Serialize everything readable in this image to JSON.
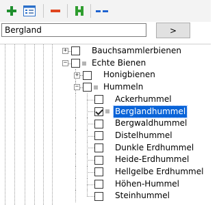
{
  "toolbar": {
    "buttons": [
      {
        "icon": "plus-icon"
      },
      {
        "icon": "properties-icon"
      },
      {
        "icon": "minus-icon"
      },
      {
        "icon": "h-icon"
      },
      {
        "icon": "dash-icon"
      }
    ],
    "colors": {
      "plus": "#1f8f2e",
      "minus": "#e0451f",
      "h": "#2f9d2f",
      "dash": "#1e62d0"
    }
  },
  "search": {
    "value": "Bergland",
    "button_label": ">"
  },
  "tree": {
    "items": [
      {
        "label": "Bauchsammlerbienen",
        "expander": "+",
        "checked": false,
        "marker": false,
        "selected": false
      },
      {
        "label": "Echte Bienen",
        "expander": "−",
        "checked": false,
        "marker": true,
        "selected": false
      },
      {
        "label": "Honigbienen",
        "expander": "+",
        "checked": false,
        "marker": false,
        "selected": false
      },
      {
        "label": "Hummeln",
        "expander": "−",
        "checked": false,
        "marker": true,
        "selected": false
      },
      {
        "label": "Ackerhummel",
        "expander": null,
        "checked": false,
        "marker": false,
        "selected": false
      },
      {
        "label": "Berglandhummel",
        "expander": null,
        "checked": true,
        "marker": true,
        "selected": true
      },
      {
        "label": "Bergwaldhummel",
        "expander": null,
        "checked": false,
        "marker": false,
        "selected": false
      },
      {
        "label": "Distelhummel",
        "expander": null,
        "checked": false,
        "marker": false,
        "selected": false
      },
      {
        "label": "Dunkle Erdhummel",
        "expander": null,
        "checked": false,
        "marker": false,
        "selected": false
      },
      {
        "label": "Heide-Erdhummel",
        "expander": null,
        "checked": false,
        "marker": false,
        "selected": false
      },
      {
        "label": "Hellgelbe Erdhummel",
        "expander": null,
        "checked": false,
        "marker": false,
        "selected": false
      },
      {
        "label": "Höhen-Hummel",
        "expander": null,
        "checked": false,
        "marker": false,
        "selected": false
      },
      {
        "label": "Steinhummel",
        "expander": null,
        "checked": false,
        "marker": false,
        "selected": false
      }
    ]
  }
}
